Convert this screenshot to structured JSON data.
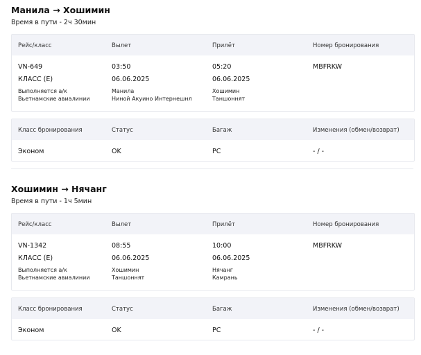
{
  "segments": [
    {
      "route": "Манила → Хошимин",
      "duration": "Время в пути - 2ч 30мин",
      "headers": [
        "Рейс/класс",
        "Вылет",
        "Прилёт",
        "Номер бронирования"
      ],
      "flight_number": "VN-649",
      "flight_class": "КЛАСС (E)",
      "operated_by": [
        "Выполняется а/к",
        "Вьетнамские авиалинии"
      ],
      "departure": {
        "time": "03:50",
        "date": "06.06.2025",
        "city": "Манила",
        "airport": "Ниной Акуино Интернешнл"
      },
      "arrival": {
        "time": "05:20",
        "date": "06.06.2025",
        "city": "Хошимин",
        "airport": "Таншоннят"
      },
      "booking_number": "MBFRKW",
      "booking_headers": [
        "Класс бронирования",
        "Статус",
        "Багаж",
        "Изменения (обмен/возврат)"
      ],
      "booking_class": "Эконом",
      "status": "OK",
      "baggage": "PC",
      "changes": "- / -"
    },
    {
      "route": "Хошимин → Нячанг",
      "duration": "Время в пути - 1ч 5мин",
      "headers": [
        "Рейс/класс",
        "Вылет",
        "Прилёт",
        "Номер бронирования"
      ],
      "flight_number": "VN-1342",
      "flight_class": "КЛАСС (E)",
      "operated_by": [
        "Выполняется а/к",
        "Вьетнамские авиалинии"
      ],
      "departure": {
        "time": "08:55",
        "date": "06.06.2025",
        "city": "Хошимин",
        "airport": "Таншоннят"
      },
      "arrival": {
        "time": "10:00",
        "date": "06.06.2025",
        "city": "Нячанг",
        "airport": "Камрань"
      },
      "booking_number": "MBFRKW",
      "booking_headers": [
        "Класс бронирования",
        "Статус",
        "Багаж",
        "Изменения (обмен/возврат)"
      ],
      "booking_class": "Эконом",
      "status": "OK",
      "baggage": "PC",
      "changes": "- / -"
    }
  ]
}
